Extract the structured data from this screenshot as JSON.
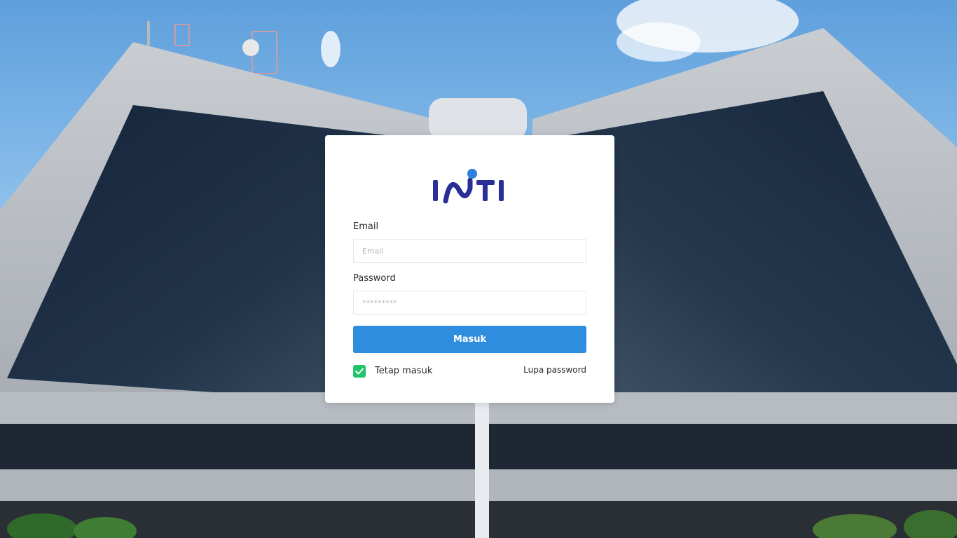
{
  "brand": {
    "logo_text": "INTI",
    "logo_color": "#2a2f97",
    "logo_dot_color": "#2e7de0"
  },
  "form": {
    "email_label": "Email",
    "email_placeholder": "Email",
    "email_value": "",
    "password_label": "Password",
    "password_placeholder": "*********",
    "password_value": "",
    "submit_label": "Masuk",
    "remember_label": "Tetap masuk",
    "remember_checked": true,
    "forgot_label": "Lupa password"
  },
  "colors": {
    "accent": "#2f8de0",
    "checkbox": "#22c46a",
    "sky": "#8fbfe6"
  }
}
